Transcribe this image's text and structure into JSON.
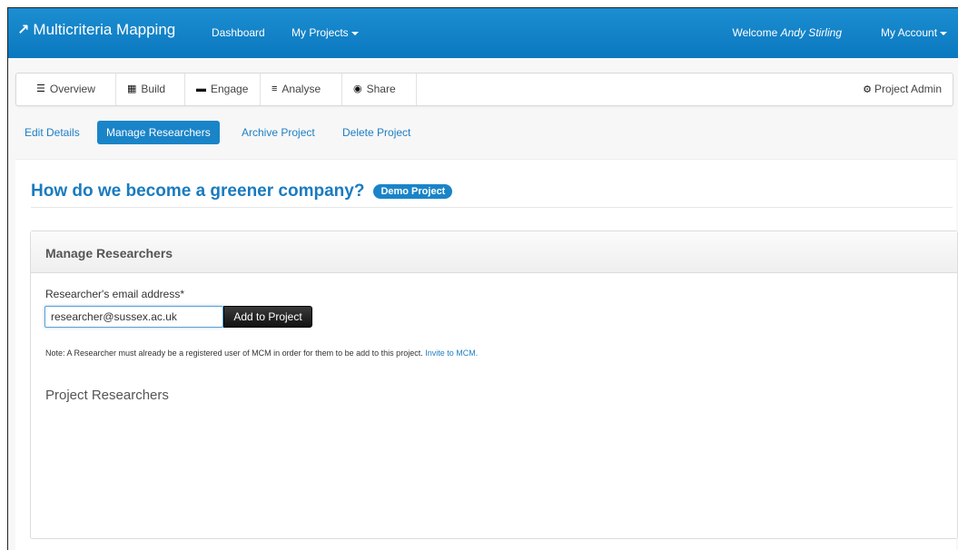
{
  "navbar": {
    "brand": "Multicriteria Mapping",
    "links": [
      "Dashboard",
      "My Projects"
    ],
    "welcome_prefix": "Welcome",
    "user_name": "Andy Stirling",
    "account": "My Account"
  },
  "tabs": [
    {
      "label": "Overview",
      "icon": "list-icon"
    },
    {
      "label": "Build",
      "icon": "grid-icon"
    },
    {
      "label": "Engage",
      "icon": "comment-icon"
    },
    {
      "label": "Analyse",
      "icon": "align-icon"
    },
    {
      "label": "Share",
      "icon": "globe-icon"
    }
  ],
  "admin": {
    "label": "Project Admin",
    "icon": "gear-icon"
  },
  "subnav": [
    "Edit Details",
    "Manage Researchers",
    "Archive Project",
    "Delete Project"
  ],
  "project": {
    "title": "How do we become a greener company?",
    "badge": "Demo Project"
  },
  "panel": {
    "heading": "Manage Researchers",
    "field_label": "Researcher's email address*",
    "email_value": "researcher@sussex.ac.uk",
    "add_button": "Add to Project",
    "note": "Note: A Researcher must already be a registered user of MCM in order for them to be add to this project.",
    "note_link": "Invite to MCM.",
    "researchers_heading": "Project Researchers"
  },
  "colors": {
    "primary": "#1a84c8",
    "navbar": "#0a78bf",
    "button_dark": "#222222"
  }
}
